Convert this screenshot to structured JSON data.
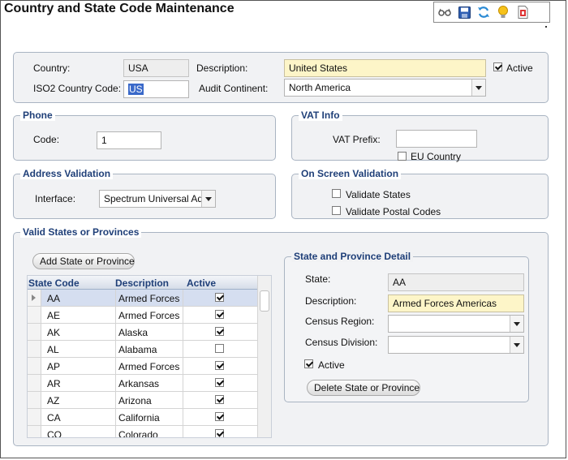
{
  "page": {
    "title": "Country and State Code  Maintenance"
  },
  "toolbar": {
    "icons": [
      "glasses-icon",
      "save-icon",
      "refresh-icon",
      "lightbulb-icon",
      "report-icon"
    ]
  },
  "country": {
    "country_label": "Country:",
    "country_value": "USA",
    "description_label": "Description:",
    "description_value": "United States",
    "active_label": "Active",
    "active_checked": true,
    "iso2_label": "ISO2 Country Code:",
    "iso2_value": "US",
    "audit_label": "Audit Continent:",
    "audit_value": "North America"
  },
  "phone": {
    "legend": "Phone",
    "code_label": "Code:",
    "code_value": "1"
  },
  "vat": {
    "legend": "VAT Info",
    "prefix_label": "VAT Prefix:",
    "prefix_value": "",
    "eu_label": "EU Country",
    "eu_checked": false
  },
  "address_validation": {
    "legend": "Address Validation",
    "interface_label": "Interface:",
    "interface_value": "Spectrum Universal Add"
  },
  "on_screen_validation": {
    "legend": "On Screen Validation",
    "validate_states_label": "Validate States",
    "validate_postal_label": "Validate Postal Codes"
  },
  "states": {
    "legend": "Valid States or Provinces",
    "add_button": "Add State or Province",
    "columns": {
      "code": "State Code",
      "description": "Description",
      "active": "Active"
    },
    "rows": [
      {
        "code": "AA",
        "description": "Armed Forces A",
        "active": true
      },
      {
        "code": "AE",
        "description": "Armed Forces E",
        "active": true
      },
      {
        "code": "AK",
        "description": "Alaska",
        "active": true
      },
      {
        "code": "AL",
        "description": "Alabama",
        "active": false
      },
      {
        "code": "AP",
        "description": "Armed Forces P",
        "active": true
      },
      {
        "code": "AR",
        "description": "Arkansas",
        "active": true
      },
      {
        "code": "AZ",
        "description": "Arizona",
        "active": true
      },
      {
        "code": "CA",
        "description": "California",
        "active": true
      },
      {
        "code": "CO",
        "description": "Colorado",
        "active": true
      }
    ]
  },
  "detail": {
    "legend": "State and Province Detail",
    "state_label": "State:",
    "state_value": "AA",
    "description_label": "Description:",
    "description_value": "Armed Forces Americas",
    "census_region_label": "Census Region:",
    "census_region_value": "",
    "census_division_label": "Census Division:",
    "census_division_value": "",
    "active_label": "Active",
    "active_checked": true,
    "delete_button": "Delete State or Province"
  }
}
